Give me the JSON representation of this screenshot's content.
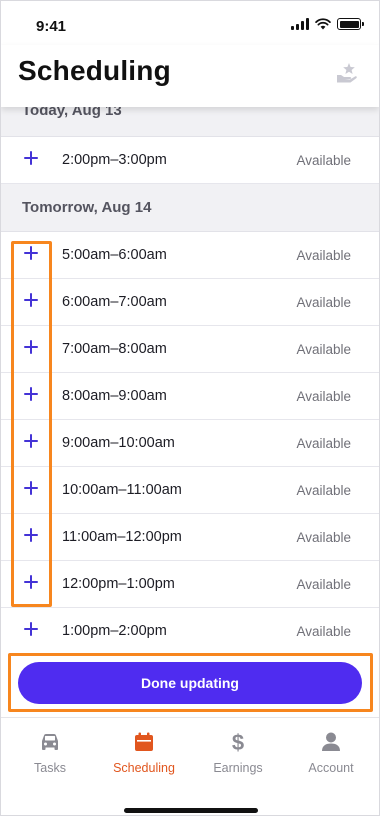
{
  "status_bar": {
    "time": "9:41"
  },
  "header": {
    "title": "Scheduling",
    "star_icon": "star-hand-icon"
  },
  "sections": [
    {
      "label": "Today, Aug 13",
      "slots": [
        {
          "time": "2:00pm–3:00pm",
          "status": "Available"
        }
      ]
    },
    {
      "label": "Tomorrow, Aug 14",
      "slots": [
        {
          "time": "5:00am–6:00am",
          "status": "Available"
        },
        {
          "time": "6:00am–7:00am",
          "status": "Available"
        },
        {
          "time": "7:00am–8:00am",
          "status": "Available"
        },
        {
          "time": "8:00am–9:00am",
          "status": "Available"
        },
        {
          "time": "9:00am–10:00am",
          "status": "Available"
        },
        {
          "time": "10:00am–11:00am",
          "status": "Available"
        },
        {
          "time": "11:00am–12:00pm",
          "status": "Available"
        },
        {
          "time": "12:00pm–1:00pm",
          "status": "Available"
        },
        {
          "time": "1:00pm–2:00pm",
          "status": "Available"
        }
      ]
    }
  ],
  "done_button": {
    "label": "Done updating"
  },
  "tabs": [
    {
      "label": "Tasks",
      "icon": "car-icon",
      "active": false
    },
    {
      "label": "Scheduling",
      "icon": "calendar-icon",
      "active": true
    },
    {
      "label": "Earnings",
      "icon": "dollar-icon",
      "active": false
    },
    {
      "label": "Account",
      "icon": "person-icon",
      "active": false
    }
  ],
  "colors": {
    "accent": "#4f2cf0",
    "plus": "#4433d6",
    "active_tab": "#e1561e",
    "highlight": "#f7861e"
  }
}
